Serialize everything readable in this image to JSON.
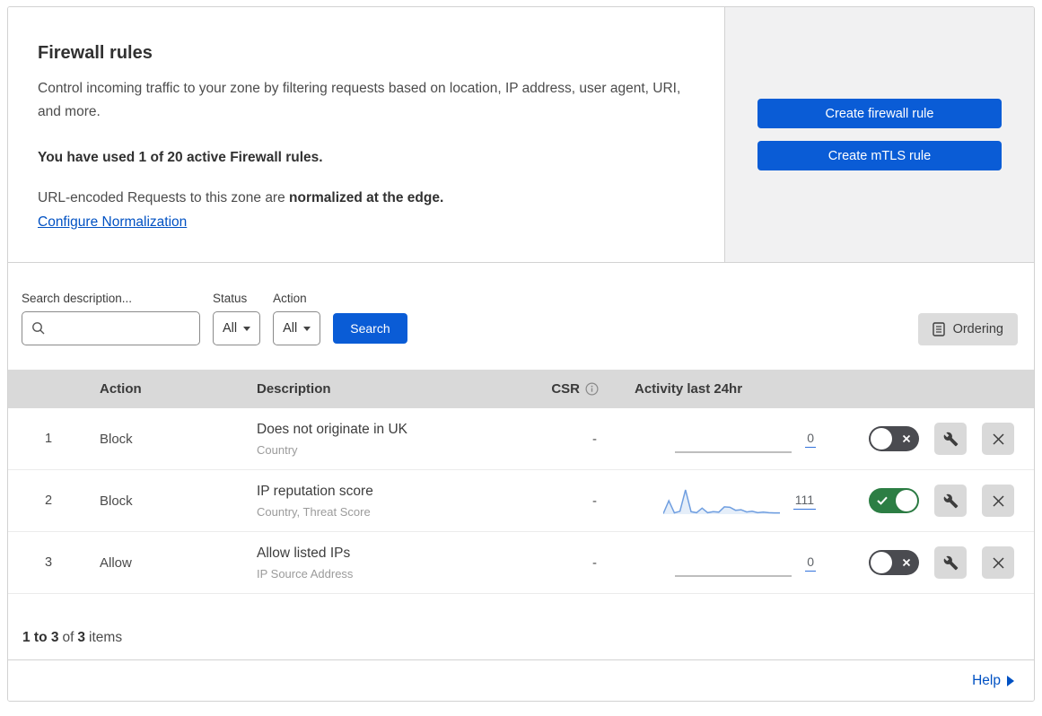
{
  "header": {
    "title": "Firewall rules",
    "description": "Control incoming traffic to your zone by filtering requests based on location, IP address, user agent, URI, and more.",
    "usage_notice": "You have used 1 of 20 active Firewall rules.",
    "normalization_text": "URL-encoded Requests to this zone are",
    "normalization_bold": "normalized at the edge.",
    "normalization_link": "Configure Normalization"
  },
  "actions_panel": {
    "create_firewall_rule": "Create firewall rule",
    "create_mtls_rule": "Create mTLS rule"
  },
  "filters": {
    "search_label": "Search description...",
    "status_label": "Status",
    "status_value": "All",
    "action_label": "Action",
    "action_value": "All",
    "search_button": "Search",
    "ordering_button": "Ordering"
  },
  "table": {
    "headers": {
      "action": "Action",
      "description": "Description",
      "csr": "CSR",
      "activity": "Activity last 24hr"
    },
    "rows": [
      {
        "priority": "1",
        "action": "Block",
        "description": "Does not originate in UK",
        "fields": "Country",
        "csr": "-",
        "activity_count": "0",
        "activity_values": [
          0,
          0,
          0,
          0,
          0,
          0,
          0,
          0,
          0,
          0,
          0,
          0
        ],
        "enabled": false
      },
      {
        "priority": "2",
        "action": "Block",
        "description": "IP reputation score",
        "fields": "Country, Threat Score",
        "csr": "-",
        "activity_count": "111",
        "activity_values": [
          2,
          55,
          5,
          12,
          100,
          10,
          6,
          25,
          6,
          10,
          8,
          30,
          28,
          16,
          18,
          9,
          12,
          6,
          8,
          6,
          5,
          5
        ],
        "enabled": true
      },
      {
        "priority": "3",
        "action": "Allow",
        "description": "Allow listed IPs",
        "fields": "IP Source Address",
        "csr": "-",
        "activity_count": "0",
        "activity_values": [
          0,
          0,
          0,
          0,
          0,
          0,
          0,
          0,
          0,
          0,
          0,
          0
        ],
        "enabled": false
      }
    ]
  },
  "footer": {
    "range": "1 to 3",
    "of_text": "of",
    "total": "3",
    "items_text": "items"
  },
  "help": {
    "label": "Help"
  },
  "colors": {
    "accent_blue": "#0a5cd6",
    "link_blue": "#0051c3",
    "toggle_on_green": "#2c7e44",
    "toggle_off_gray": "#4a4b50",
    "sparkline_blue": "#6f9ee0",
    "sparkline_flat_gray": "#a9a9a9",
    "table_header_bg": "#d9d9d9",
    "side_panel_bg": "#f1f1f2"
  }
}
